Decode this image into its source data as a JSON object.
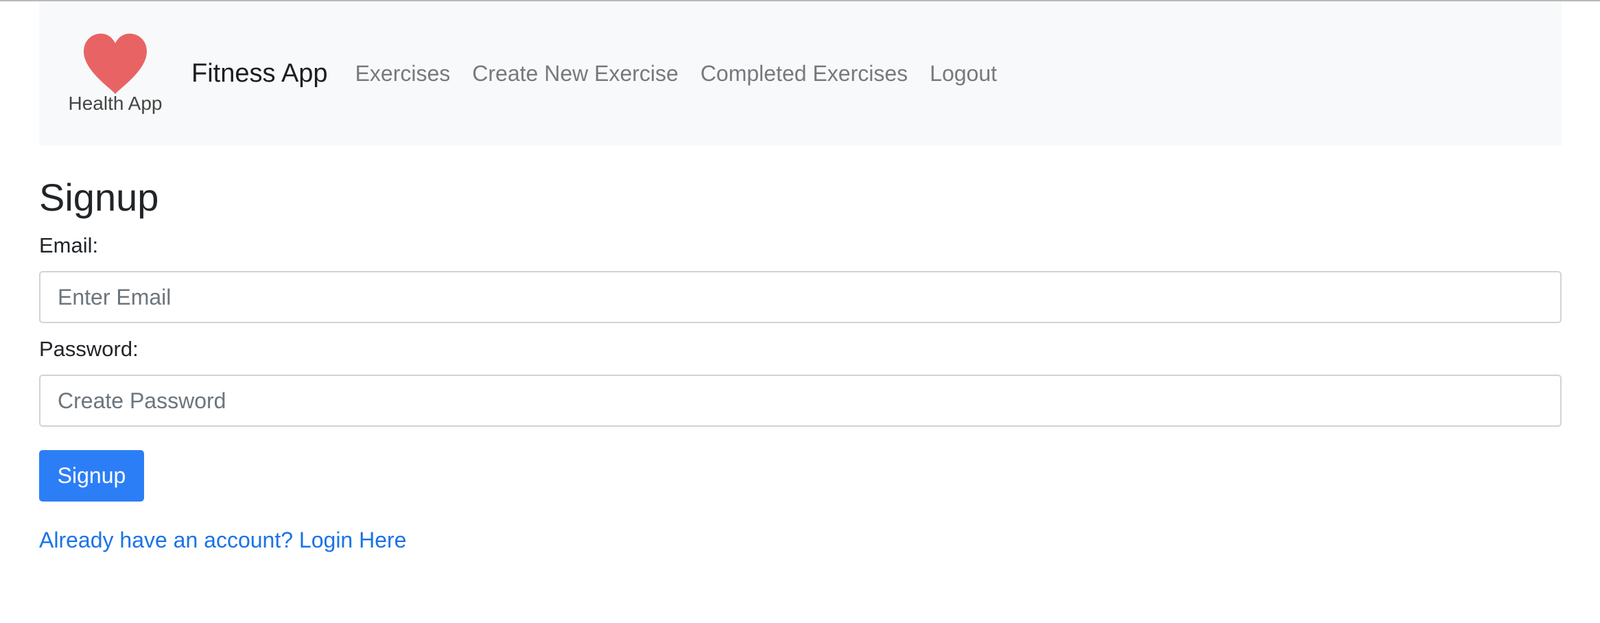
{
  "navbar": {
    "logo_text": "Health App",
    "brand": "Fitness App",
    "links": [
      {
        "label": "Exercises"
      },
      {
        "label": "Create New Exercise"
      },
      {
        "label": "Completed Exercises"
      },
      {
        "label": "Logout"
      }
    ]
  },
  "page": {
    "title": "Signup"
  },
  "form": {
    "email_label": "Email:",
    "email_placeholder": "Enter Email",
    "email_value": "",
    "password_label": "Password:",
    "password_placeholder": "Create Password",
    "password_value": "",
    "submit_label": "Signup"
  },
  "footer_link": {
    "label": "Already have an account? Login Here"
  },
  "colors": {
    "navbar_bg": "#f8f9fa",
    "primary_button": "#2c7ef7",
    "link": "#1a73e8",
    "heart": "#e86464"
  },
  "icons": {
    "logo": "heart-icon"
  }
}
